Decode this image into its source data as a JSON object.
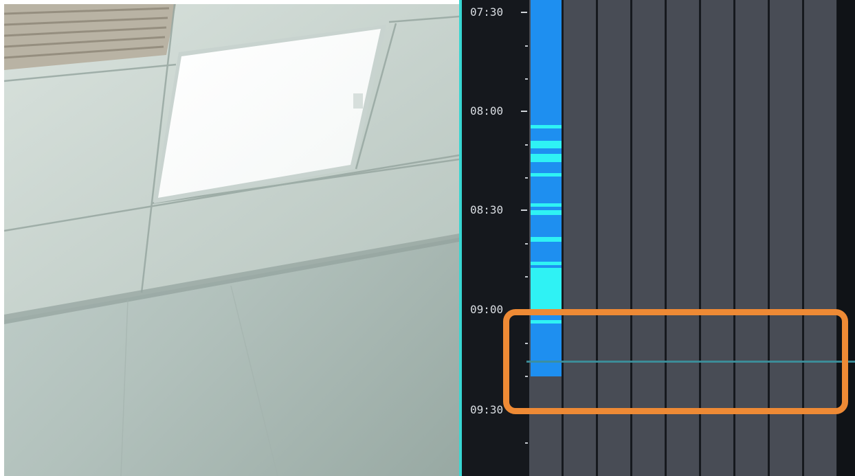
{
  "camera": {
    "scene": "ceiling-and-wall"
  },
  "timeline": {
    "time_labels": [
      "07:30",
      "08:00",
      "08:30",
      "09:00",
      "09:30"
    ],
    "track_count": 9,
    "recording": {
      "start": "07:30",
      "end": "09:17"
    },
    "playhead_time": "09:15"
  },
  "colors": {
    "divider": "#38d6d2",
    "timeline_background": "#15181d",
    "track": "#484c55",
    "recording": "#1e8ff0",
    "event": "#2ff2f4",
    "playhead": "#3c8f9c",
    "highlight": "#ee8a35"
  }
}
